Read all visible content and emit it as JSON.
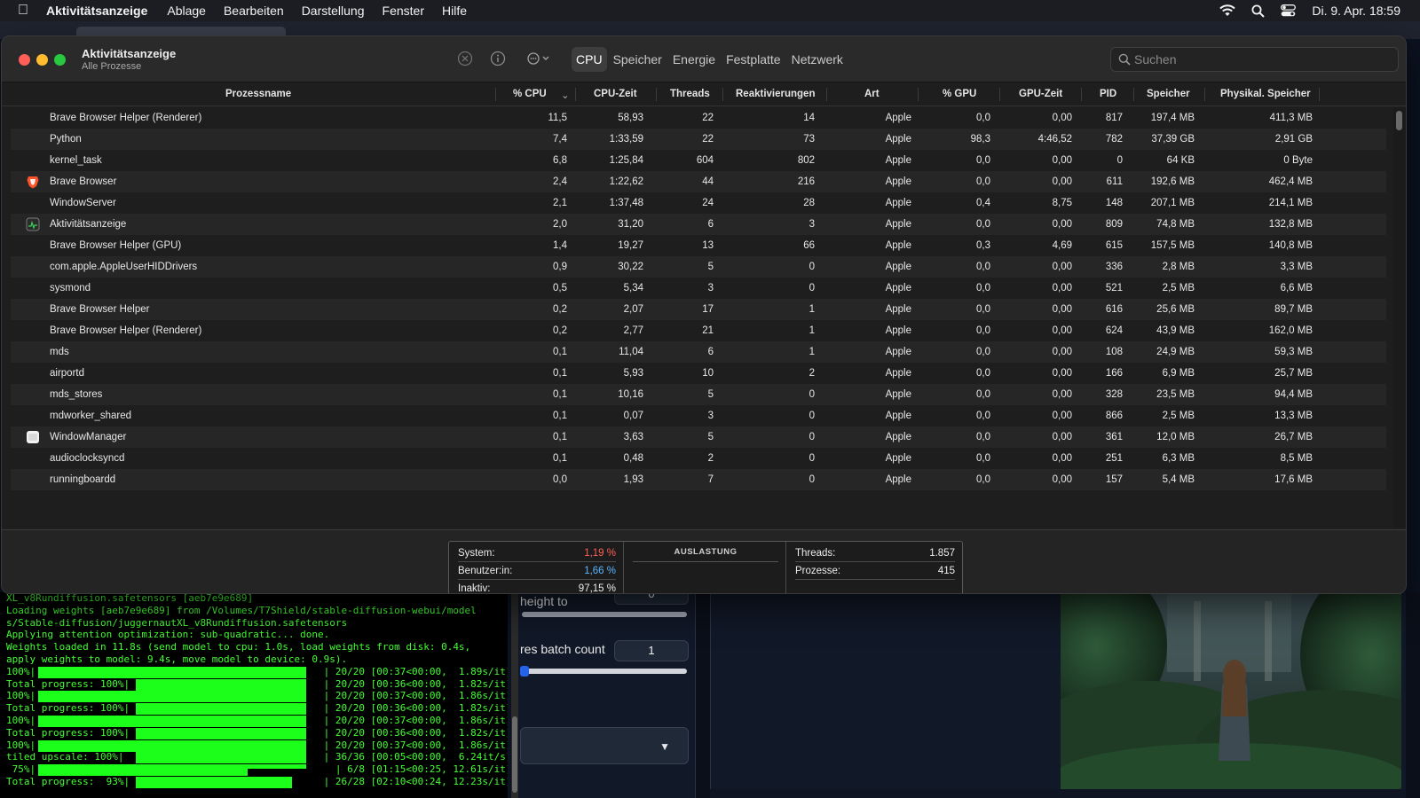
{
  "menubar": {
    "app_name": "Aktivitätsanzeige",
    "menus": [
      "Ablage",
      "Bearbeiten",
      "Darstellung",
      "Fenster",
      "Hilfe"
    ],
    "datetime": "Di. 9. Apr.  18:59"
  },
  "window": {
    "title": "Aktivitätsanzeige",
    "subtitle": "Alle Prozesse",
    "tabs": [
      "CPU",
      "Speicher",
      "Energie",
      "Festplatte",
      "Netzwerk"
    ],
    "active_tab": "CPU",
    "search_placeholder": "Suchen"
  },
  "table": {
    "columns": [
      "Prozessname",
      "% CPU",
      "CPU-Zeit",
      "Threads",
      "Reaktivierungen",
      "Art",
      "% GPU",
      "GPU-Zeit",
      "PID",
      "Speicher",
      "Physikal. Speicher"
    ],
    "sort_column": "% CPU",
    "rows": [
      {
        "icon": "",
        "name": "Brave Browser Helper (Renderer)",
        "cpu": "11,5",
        "cpu_time": "58,93",
        "threads": "22",
        "wakeups": "14",
        "kind": "Apple",
        "gpu": "0,0",
        "gpu_time": "0,00",
        "pid": "817",
        "mem": "197,4 MB",
        "phys": "411,3 MB"
      },
      {
        "icon": "",
        "name": "Python",
        "cpu": "7,4",
        "cpu_time": "1:33,59",
        "threads": "22",
        "wakeups": "73",
        "kind": "Apple",
        "gpu": "98,3",
        "gpu_time": "4:46,52",
        "pid": "782",
        "mem": "37,39 GB",
        "phys": "2,91 GB"
      },
      {
        "icon": "",
        "name": "kernel_task",
        "cpu": "6,8",
        "cpu_time": "1:25,84",
        "threads": "604",
        "wakeups": "802",
        "kind": "Apple",
        "gpu": "0,0",
        "gpu_time": "0,00",
        "pid": "0",
        "mem": "64 KB",
        "phys": "0 Byte"
      },
      {
        "icon": "brave-lion-icon",
        "name": "Brave Browser",
        "cpu": "2,4",
        "cpu_time": "1:22,62",
        "threads": "44",
        "wakeups": "216",
        "kind": "Apple",
        "gpu": "0,0",
        "gpu_time": "0,00",
        "pid": "611",
        "mem": "192,6 MB",
        "phys": "462,4 MB"
      },
      {
        "icon": "",
        "name": "WindowServer",
        "cpu": "2,1",
        "cpu_time": "1:37,48",
        "threads": "24",
        "wakeups": "28",
        "kind": "Apple",
        "gpu": "0,4",
        "gpu_time": "8,75",
        "pid": "148",
        "mem": "207,1 MB",
        "phys": "214,1 MB"
      },
      {
        "icon": "activity-monitor-icon",
        "name": "Aktivitätsanzeige",
        "cpu": "2,0",
        "cpu_time": "31,20",
        "threads": "6",
        "wakeups": "3",
        "kind": "Apple",
        "gpu": "0,0",
        "gpu_time": "0,00",
        "pid": "809",
        "mem": "74,8 MB",
        "phys": "132,8 MB"
      },
      {
        "icon": "",
        "name": "Brave Browser Helper (GPU)",
        "cpu": "1,4",
        "cpu_time": "19,27",
        "threads": "13",
        "wakeups": "66",
        "kind": "Apple",
        "gpu": "0,3",
        "gpu_time": "4,69",
        "pid": "615",
        "mem": "157,5 MB",
        "phys": "140,8 MB"
      },
      {
        "icon": "",
        "name": "com.apple.AppleUserHIDDrivers",
        "cpu": "0,9",
        "cpu_time": "30,22",
        "threads": "5",
        "wakeups": "0",
        "kind": "Apple",
        "gpu": "0,0",
        "gpu_time": "0,00",
        "pid": "336",
        "mem": "2,8 MB",
        "phys": "3,3 MB"
      },
      {
        "icon": "",
        "name": "sysmond",
        "cpu": "0,5",
        "cpu_time": "5,34",
        "threads": "3",
        "wakeups": "0",
        "kind": "Apple",
        "gpu": "0,0",
        "gpu_time": "0,00",
        "pid": "521",
        "mem": "2,5 MB",
        "phys": "6,6 MB"
      },
      {
        "icon": "",
        "name": "Brave Browser Helper",
        "cpu": "0,2",
        "cpu_time": "2,07",
        "threads": "17",
        "wakeups": "1",
        "kind": "Apple",
        "gpu": "0,0",
        "gpu_time": "0,00",
        "pid": "616",
        "mem": "25,6 MB",
        "phys": "89,7 MB"
      },
      {
        "icon": "",
        "name": "Brave Browser Helper (Renderer)",
        "cpu": "0,2",
        "cpu_time": "2,77",
        "threads": "21",
        "wakeups": "1",
        "kind": "Apple",
        "gpu": "0,0",
        "gpu_time": "0,00",
        "pid": "624",
        "mem": "43,9 MB",
        "phys": "162,0 MB"
      },
      {
        "icon": "",
        "name": "mds",
        "cpu": "0,1",
        "cpu_time": "11,04",
        "threads": "6",
        "wakeups": "1",
        "kind": "Apple",
        "gpu": "0,0",
        "gpu_time": "0,00",
        "pid": "108",
        "mem": "24,9 MB",
        "phys": "59,3 MB"
      },
      {
        "icon": "",
        "name": "airportd",
        "cpu": "0,1",
        "cpu_time": "5,93",
        "threads": "10",
        "wakeups": "2",
        "kind": "Apple",
        "gpu": "0,0",
        "gpu_time": "0,00",
        "pid": "166",
        "mem": "6,9 MB",
        "phys": "25,7 MB"
      },
      {
        "icon": "",
        "name": "mds_stores",
        "cpu": "0,1",
        "cpu_time": "10,16",
        "threads": "5",
        "wakeups": "0",
        "kind": "Apple",
        "gpu": "0,0",
        "gpu_time": "0,00",
        "pid": "328",
        "mem": "23,5 MB",
        "phys": "94,4 MB"
      },
      {
        "icon": "",
        "name": "mdworker_shared",
        "cpu": "0,1",
        "cpu_time": "0,07",
        "threads": "3",
        "wakeups": "0",
        "kind": "Apple",
        "gpu": "0,0",
        "gpu_time": "0,00",
        "pid": "866",
        "mem": "2,5 MB",
        "phys": "13,3 MB"
      },
      {
        "icon": "window-manager-icon",
        "name": "WindowManager",
        "cpu": "0,1",
        "cpu_time": "3,63",
        "threads": "5",
        "wakeups": "0",
        "kind": "Apple",
        "gpu": "0,0",
        "gpu_time": "0,00",
        "pid": "361",
        "mem": "12,0 MB",
        "phys": "26,7 MB"
      },
      {
        "icon": "",
        "name": "audioclocksyncd",
        "cpu": "0,1",
        "cpu_time": "0,48",
        "threads": "2",
        "wakeups": "0",
        "kind": "Apple",
        "gpu": "0,0",
        "gpu_time": "0,00",
        "pid": "251",
        "mem": "6,3 MB",
        "phys": "8,5 MB"
      },
      {
        "icon": "",
        "name": "runningboardd",
        "cpu": "0,0",
        "cpu_time": "1,93",
        "threads": "7",
        "wakeups": "0",
        "kind": "Apple",
        "gpu": "0,0",
        "gpu_time": "0,00",
        "pid": "157",
        "mem": "5,4 MB",
        "phys": "17,6 MB"
      }
    ]
  },
  "footer": {
    "system_label": "System:",
    "system_value": "1,19 %",
    "system_color": "#ff5f57",
    "user_label": "Benutzer:in:",
    "user_value": "1,66 %",
    "user_color": "#5ab4ff",
    "idle_label": "Inaktiv:",
    "idle_value": "97,15 %",
    "load_title": "AUSLASTUNG",
    "threads_label": "Threads:",
    "threads_value": "1.857",
    "processes_label": "Prozesse:",
    "processes_value": "415"
  },
  "terminal": {
    "lines": [
      {
        "text": "XL_v8Rundiffusion.safetensors [aeb7e9e689]",
        "bar": null
      },
      {
        "text": "Loading weights [aeb7e9e689] from /Volumes/T7Shield/stable-diffusion-webui/model",
        "bar": null
      },
      {
        "text": "s/Stable-diffusion/juggernautXL_v8Rundiffusion.safetensors",
        "bar": null
      },
      {
        "text": "Applying attention optimization: sub-quadratic... done.",
        "bar": null
      },
      {
        "text": "Weights loaded in 11.8s (send model to cpu: 1.0s, load weights from disk: 0.4s,",
        "bar": null
      },
      {
        "text": "apply weights to model: 9.4s, move model to device: 0.9s).",
        "bar": null
      },
      {
        "text": "100%|                                                 | 20/20 [00:37<00:00,  1.89s/it]",
        "bar": "short"
      },
      {
        "text": "Total progress: 100%|                                 | 20/20 [00:36<00:00,  1.82s/it]",
        "bar": "long"
      },
      {
        "text": "100%|                                                 | 20/20 [00:37<00:00,  1.86s/it]",
        "bar": "short"
      },
      {
        "text": "Total progress: 100%|                                 | 20/20 [00:36<00:00,  1.82s/it]",
        "bar": "long"
      },
      {
        "text": "100%|                                                 | 20/20 [00:37<00:00,  1.86s/it]",
        "bar": "short"
      },
      {
        "text": "Total progress: 100%|                                 | 20/20 [00:36<00:00,  1.82s/it]",
        "bar": "long"
      },
      {
        "text": "100%|                                                 | 20/20 [00:37<00:00,  1.86s/it]",
        "bar": "short"
      },
      {
        "text": "tiled upscale: 100%|                                  | 36/36 [00:05<00:00,  6.24it/s]",
        "bar": "long"
      },
      {
        "text": " 75%|                                                   | 6/8 [01:15<00:25, 12.61s/it]",
        "bar": "partial"
      },
      {
        "text": "Total progress:  93%|                                 | 26/28 [02:10<00:24, 12.23s/it]",
        "bar": "long93"
      }
    ]
  },
  "webui": {
    "height_label": "height to",
    "height_value": "0",
    "batch_label": "res batch count",
    "batch_value": "1"
  }
}
